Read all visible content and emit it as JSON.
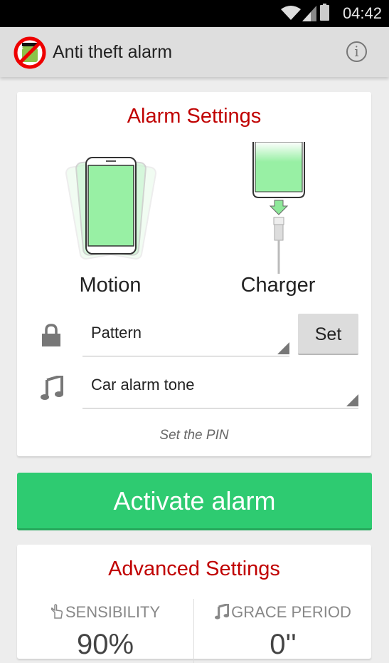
{
  "status_bar": {
    "time": "04:42",
    "icons": [
      "wifi-icon",
      "signal-icon",
      "battery-icon"
    ]
  },
  "app_bar": {
    "title": "Anti theft alarm",
    "logo": "no-android-thief-logo",
    "info_icon": "i"
  },
  "alarm_settings": {
    "title": "Alarm Settings",
    "modes": [
      {
        "label": "Motion",
        "icon": "phone-motion-illustration"
      },
      {
        "label": "Charger",
        "icon": "phone-charger-illustration"
      }
    ],
    "lock_type": {
      "icon": "lock-icon",
      "value": "Pattern",
      "set_button": "Set"
    },
    "tone": {
      "icon": "music-note-icon",
      "value": "Car alarm tone"
    },
    "hint": "Set the PIN"
  },
  "activate_button": "Activate alarm",
  "advanced_settings": {
    "title": "Advanced Settings",
    "sensibility": {
      "icon": "hand-pointer-icon",
      "label": "SENSIBILITY",
      "value": "90%"
    },
    "grace_period": {
      "icon": "music-note-icon",
      "label": "GRACE PERIOD",
      "value": "0''"
    }
  },
  "colors": {
    "accent_red": "#c00000",
    "activate_green": "#2ecb71",
    "screen_green": "#98f0a4"
  }
}
